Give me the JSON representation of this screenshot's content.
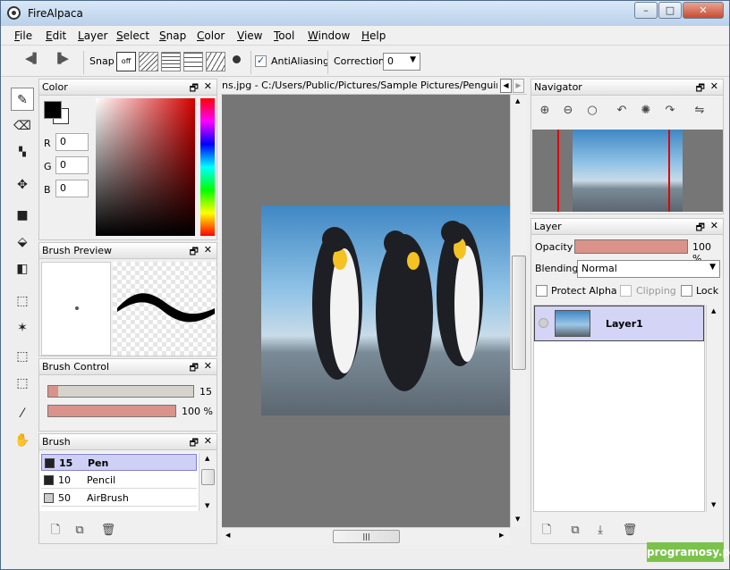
{
  "window": {
    "title": "FireAlpaca",
    "min": "–",
    "max": "□",
    "close": "✕"
  },
  "menu": [
    "File",
    "Edit",
    "Layer",
    "Select",
    "Snap",
    "Color",
    "View",
    "Tool",
    "Window",
    "Help"
  ],
  "toolbar": {
    "snap_label": "Snap",
    "snap_off": "off",
    "antialias_label": "AntiAliasing",
    "antialias_checked": true,
    "correction_label": "Correction",
    "correction_value": "0"
  },
  "tools": [
    "pen-icon",
    "eraser-icon",
    "dot-pattern-icon",
    "move-icon",
    "fill-square-icon",
    "bucket-icon",
    "gradient-icon",
    "select-rect-icon",
    "magic-wand-icon",
    "select-pen-icon",
    "select-eraser-icon",
    "eyedropper-icon",
    "hand-icon"
  ],
  "color_panel": {
    "title": "Color",
    "r_label": "R",
    "g_label": "G",
    "b_label": "B",
    "r": "0",
    "g": "0",
    "b": "0",
    "fg": "#000000",
    "bg": "#ffffff"
  },
  "brush_preview": {
    "title": "Brush Preview"
  },
  "brush_control": {
    "title": "Brush Control",
    "size": "15",
    "opacity": "100 %",
    "size_fraction": 0.07,
    "opacity_fraction": 1.0
  },
  "brush_panel": {
    "title": "Brush",
    "items": [
      {
        "size": "15",
        "name": "Pen",
        "selected": true,
        "swatch": "#222222"
      },
      {
        "size": "10",
        "name": "Pencil",
        "selected": false,
        "swatch": "#222222"
      },
      {
        "size": "50",
        "name": "AirBrush",
        "selected": false,
        "swatch": "#cccccc"
      }
    ]
  },
  "document": {
    "tab_title": "ns.jpg - C:/Users/Public/Pictures/Sample Pictures/Penguins.jpg"
  },
  "navigator": {
    "title": "Navigator"
  },
  "layer_panel": {
    "title": "Layer",
    "opacity_label": "Opacity",
    "opacity_value": "100 %",
    "blending_label": "Blending",
    "blending_value": "Normal",
    "protect_alpha": "Protect Alpha",
    "clipping": "Clipping",
    "lock": "Lock",
    "layers": [
      {
        "name": "Layer1",
        "selected": true
      }
    ]
  },
  "watermark": "programosy.pl"
}
